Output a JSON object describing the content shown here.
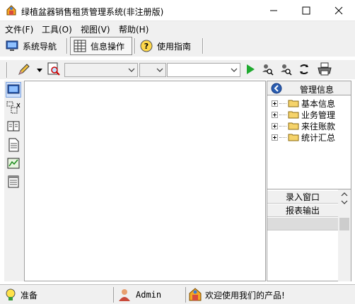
{
  "window": {
    "title": "绿植盆器销售租赁管理系统(非注册版)"
  },
  "menu": {
    "items": [
      "文件(F)",
      "工具(O)",
      "视图(V)",
      "帮助(H)"
    ]
  },
  "nav": {
    "system_nav": "系统导航",
    "info_ops": "信息操作",
    "guide": "使用指南"
  },
  "right_panel": {
    "header": "管理信息",
    "tree": [
      "基本信息",
      "业务管理",
      "来往账款",
      "统计汇总"
    ],
    "lower_items": [
      "录入窗口",
      "报表输出"
    ]
  },
  "status": {
    "ready": "准备",
    "user": "Admin",
    "message": "欢迎使用我们的产品!"
  },
  "colors": {
    "accent": "#2a5db0",
    "folder": "#f5d36a",
    "panel_bg": "#f0f0f0"
  }
}
